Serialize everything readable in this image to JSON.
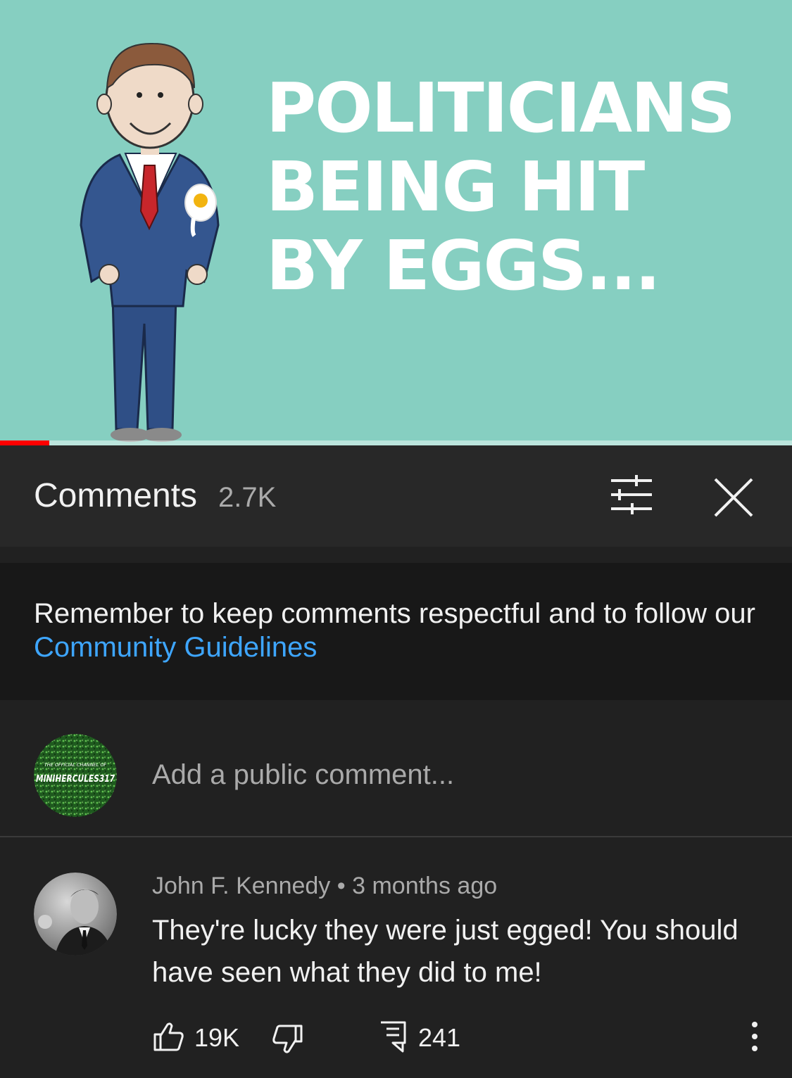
{
  "video": {
    "thumbnail_title_lines": [
      "POLITICIANS",
      "BEING HIT",
      "BY EGGS..."
    ],
    "progress_fraction": 0.062,
    "colors": {
      "background": "#86cfc1",
      "progress": "#ff0000"
    }
  },
  "comments_panel": {
    "title": "Comments",
    "count": "2.7K",
    "filter_icon": "sliders-icon",
    "close_icon": "close-icon"
  },
  "notice": {
    "text": "Remember to keep comments respectful and to follow our ",
    "link_text": "Community Guidelines",
    "link_color": "#3ea6ff"
  },
  "add_comment": {
    "avatar_text_small": "THE OFFICIAL CHANNEL OF",
    "avatar_text_large": "MINIHERCULES317",
    "placeholder": "Add a public comment..."
  },
  "comment": {
    "author": "John F. Kennedy",
    "separator": "•",
    "time": "3 months ago",
    "text": "They're lucky they were just egged! You should have seen what they did to me!",
    "likes": "19K",
    "replies": "241"
  }
}
